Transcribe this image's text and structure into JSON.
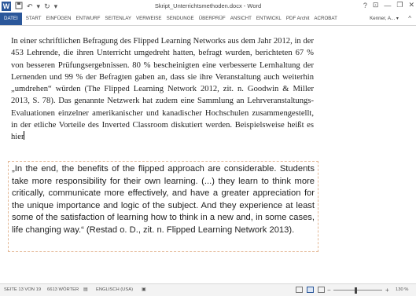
{
  "titlebar": {
    "app_letter": "W",
    "title": "Skript_Unterrichtsmethoden.docx - Word",
    "help": "?",
    "minimize": "—",
    "restore": "❐",
    "close": "✕"
  },
  "ribbon": {
    "tabs": [
      "DATEI",
      "START",
      "EINFÜGEN",
      "ENTWURF",
      "SEITENLAY",
      "VERWEISE",
      "SENDUNGE",
      "ÜBERPRÜF",
      "ANSICHT",
      "ENTWICKL",
      "PDF Archit",
      "ACROBAT"
    ],
    "user": "Kenner, A... ▾",
    "collapse": "^"
  },
  "document": {
    "paragraph": "In einer schriftlichen Befragung des Flipped Learning Networks aus dem Jahr 2012, in der 453 Lehrende, die ihren Unterricht umgedreht hatten, befragt wurden, berichteten 67 % von besseren Prüfungsergebnissen. 80 % bescheinigten eine verbesserte Lernhaltung der Lernenden und 99 % der Befragten gaben an, dass sie ihre Veranstaltung auch weiterhin „umdrehen“ würden (The Flipped Learning Network 2012, zit. n. Goodwin & Miller 2013, S. 78). Das genannte Netzwerk hat zudem eine Sammlung an Lehrveranstaltungs-Evaluationen einzelner amerikanischer und kanadischer Hochschulen zusammengestellt, in der etliche Vorteile des Inverted Classroom diskutiert werden. Beispielsweise heißt es hier",
    "quote": "„In the end, the benefits of the flipped approach are considerable. Students take more responsibility for their own learning. (...) they learn to think more critically, communicate more effectively, and have a greater appreciation for the unique importance and logic of the subject. And they experience at least some of the satisfaction of learning how to think in a new and, in some cases, life changing way.“ (Restad o. D., zit. n. Flipped Learning Network 2013)."
  },
  "statusbar": {
    "page": "SEITE 13 VON 19",
    "words": "6613 WÖRTER",
    "language": "ENGLISCH (USA)",
    "zoom_minus": "−",
    "zoom_plus": "+",
    "zoom": "130 %",
    "zoom_level": 0.45
  },
  "colors": {
    "accent": "#2b579a",
    "quote_border": "#e4b896"
  }
}
